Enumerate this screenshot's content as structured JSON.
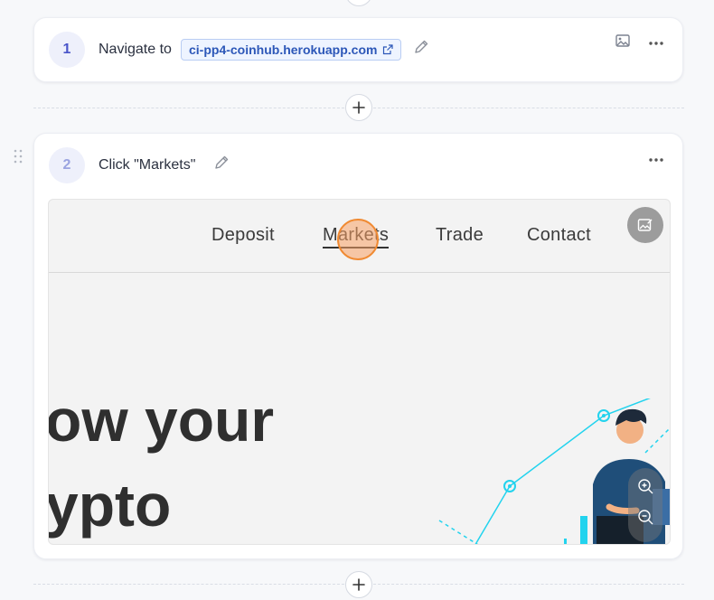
{
  "step1": {
    "number": "1",
    "text": "Navigate to",
    "url": "ci-pp4-coinhub.herokuapp.com"
  },
  "step2": {
    "number": "2",
    "text": "Click \"Markets\"",
    "screenshot": {
      "nav": [
        "Deposit",
        "Markets",
        "Trade",
        "Contact"
      ],
      "hero_line1": "ow your",
      "hero_line2": "ypto"
    }
  },
  "icons": {
    "add": "plus-icon",
    "edit": "pencil-icon",
    "image": "image-icon",
    "more": "more-horizontal-icon",
    "external": "external-link-icon",
    "drag": "drag-handle-icon",
    "zoom_in": "zoom-in-icon",
    "zoom_out": "zoom-out-icon"
  },
  "colors": {
    "step_accent": "#4a55c9",
    "url_chip": "#2c57b8",
    "click_marker": "#f08a32",
    "chart_line": "#22d3ee"
  }
}
